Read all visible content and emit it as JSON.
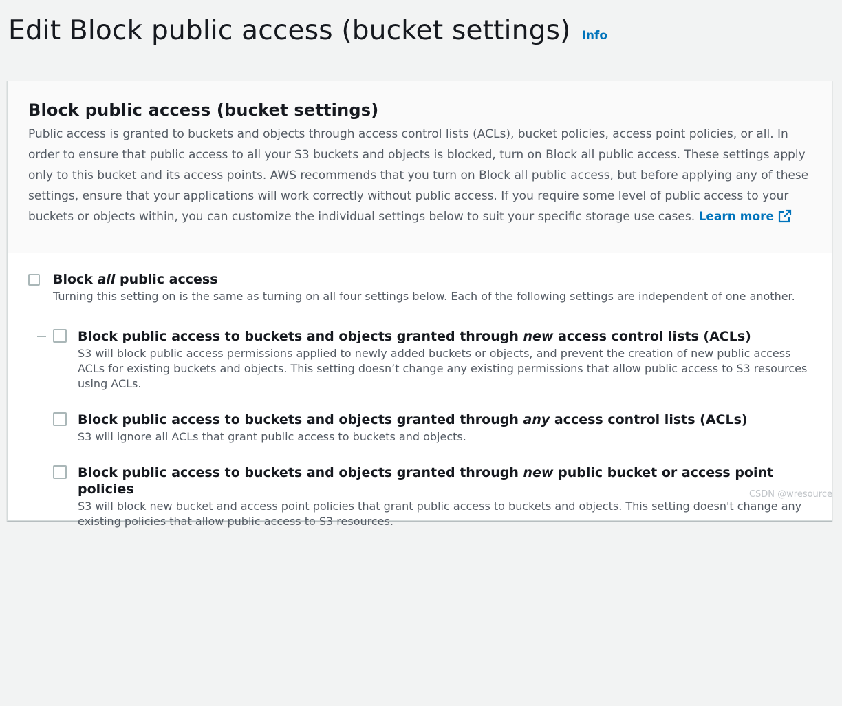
{
  "header": {
    "title": "Edit Block public access (bucket settings)",
    "info_label": "Info"
  },
  "panel": {
    "title": "Block public access (bucket settings)",
    "description": "Public access is granted to buckets and objects through access control lists (ACLs), bucket policies, access point policies, or all. In order to ensure that public access to all your S3 buckets and objects is blocked, turn on Block all public access. These settings apply only to this bucket and its access points. AWS recommends that you turn on Block all public access, but before applying any of these settings, ensure that your applications will work correctly without public access. If you require some level of public access to your buckets or objects within, you can customize the individual settings below to suit your specific storage use cases.",
    "learn_more": "Learn more"
  },
  "master_option": {
    "title_before": "Block ",
    "title_emph": "all",
    "title_after": " public access",
    "description": "Turning this setting on is the same as turning on all four settings below. Each of the following settings are independent of one another.",
    "checked": false
  },
  "sub_options": [
    {
      "title_before": "Block public access to buckets and objects granted through ",
      "title_emph": "new",
      "title_after": " access control lists (ACLs)",
      "description": "S3 will block public access permissions applied to newly added buckets or objects, and prevent the creation of new public access ACLs for existing buckets and objects. This setting doesn’t change any existing permissions that allow public access to S3 resources using ACLs.",
      "checked": false
    },
    {
      "title_before": "Block public access to buckets and objects granted through ",
      "title_emph": "any",
      "title_after": " access control lists (ACLs)",
      "description": "S3 will ignore all ACLs that grant public access to buckets and objects.",
      "checked": false
    },
    {
      "title_before": "Block public access to buckets and objects granted through ",
      "title_emph": "new",
      "title_after": " public bucket or access point policies",
      "description": "S3 will block new bucket and access point policies that grant public access to buckets and objects. This setting doesn't change any existing policies that allow public access to S3 resources.",
      "checked": false
    }
  ],
  "watermark": "CSDN @wresource",
  "colors": {
    "link": "#0073bb",
    "page_bg": "#f2f3f3",
    "text": "#16191f",
    "muted_text": "#545b64",
    "checkbox_border": "#aab7b8"
  },
  "icons": {
    "learn_more": "external-link-icon"
  }
}
